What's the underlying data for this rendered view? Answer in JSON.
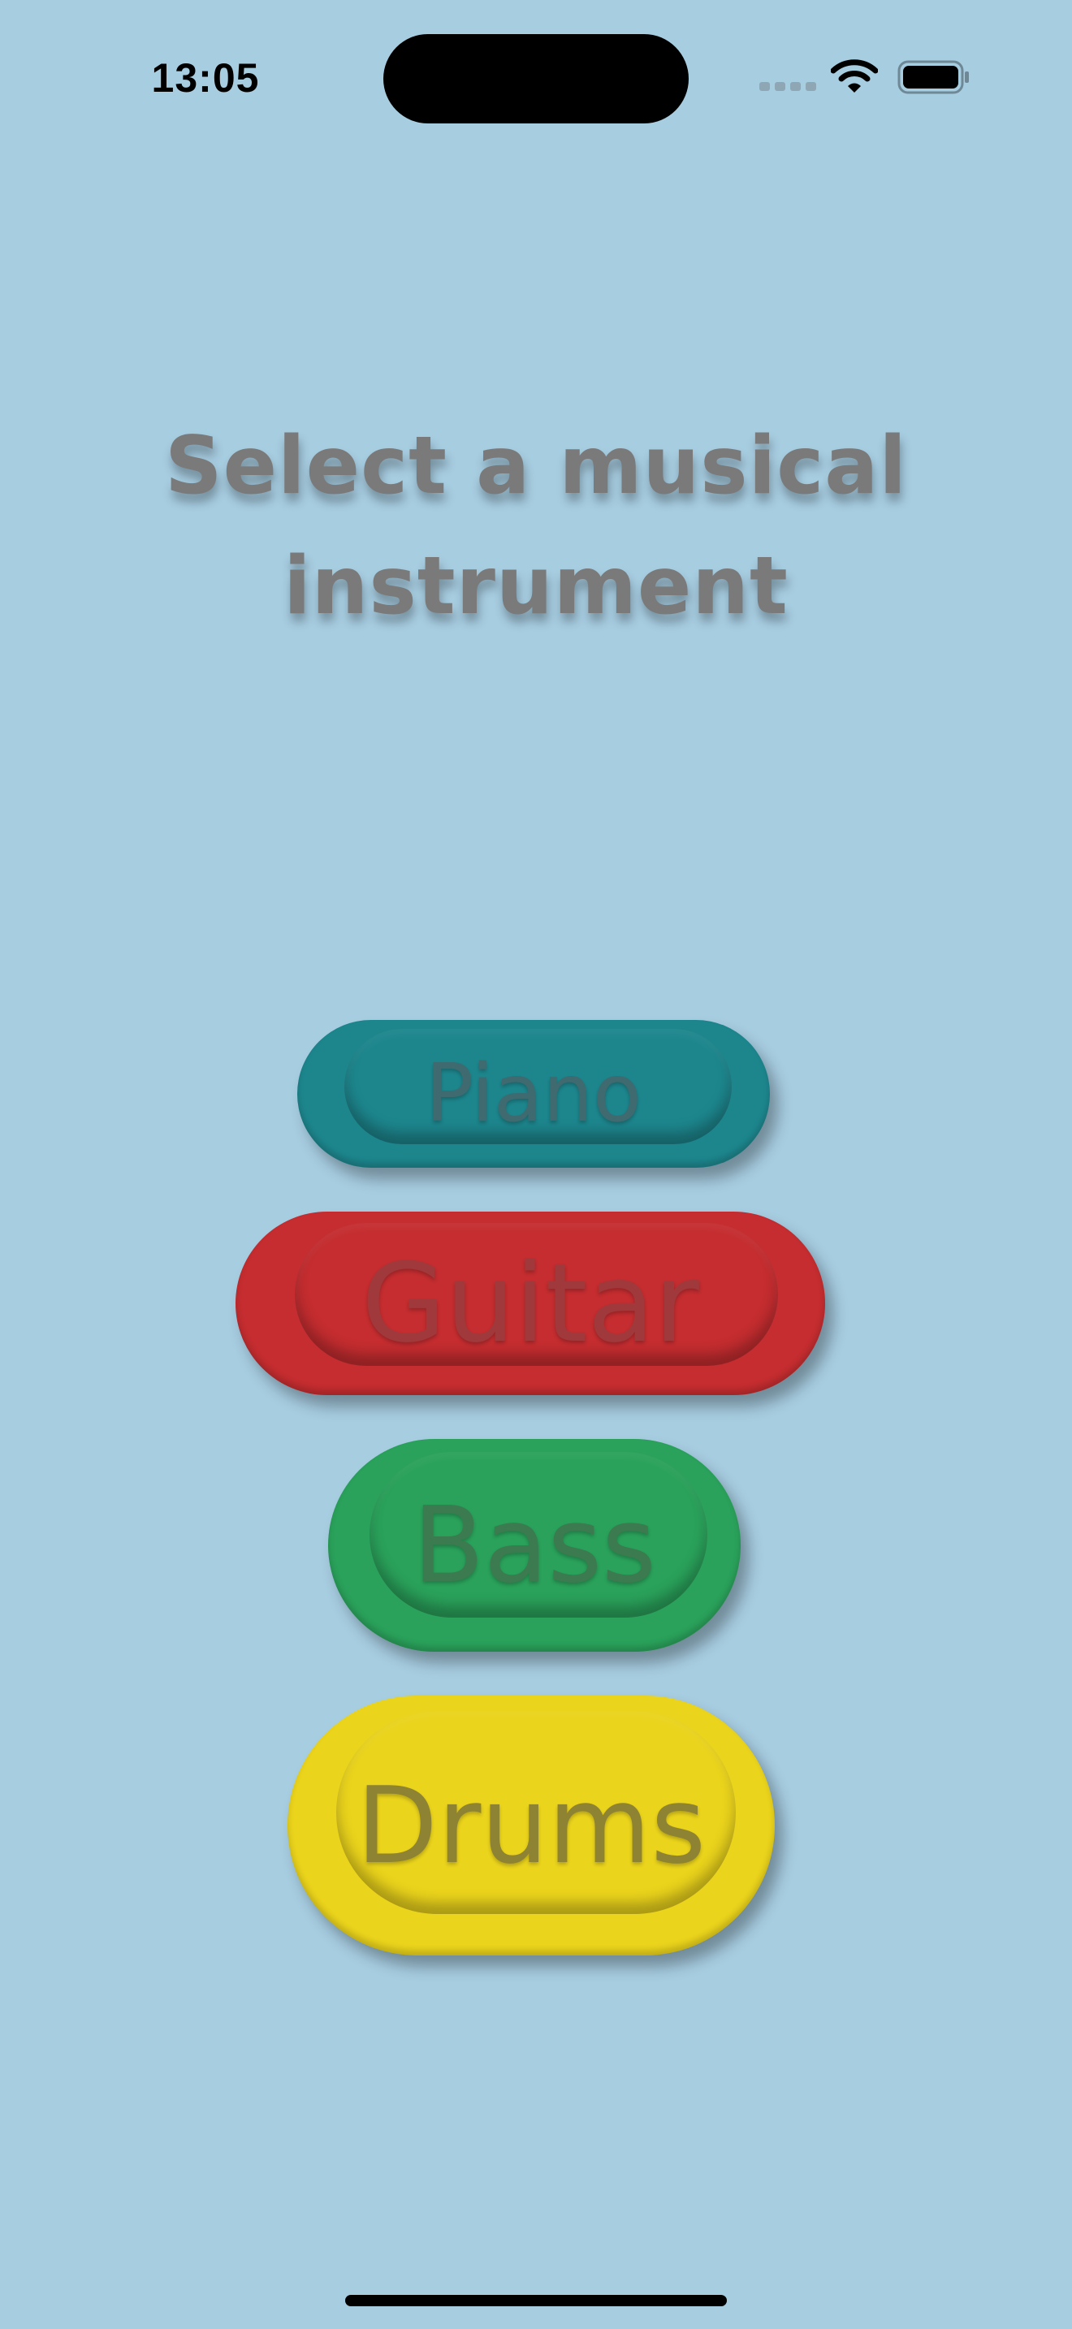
{
  "status_bar": {
    "time": "13:05",
    "icons": [
      "cellular-signal-icon",
      "wifi-icon",
      "battery-icon"
    ]
  },
  "title": "Select a musical instrument",
  "instruments": [
    {
      "label": "Piano",
      "color": "#1d868d"
    },
    {
      "label": "Guitar",
      "color": "#c52d30"
    },
    {
      "label": "Bass",
      "color": "#2aa25b"
    },
    {
      "label": "Drums",
      "color": "#ebd41c"
    }
  ],
  "colors": {
    "background": "#a7cde1",
    "title_text": "#7a7a7a"
  }
}
